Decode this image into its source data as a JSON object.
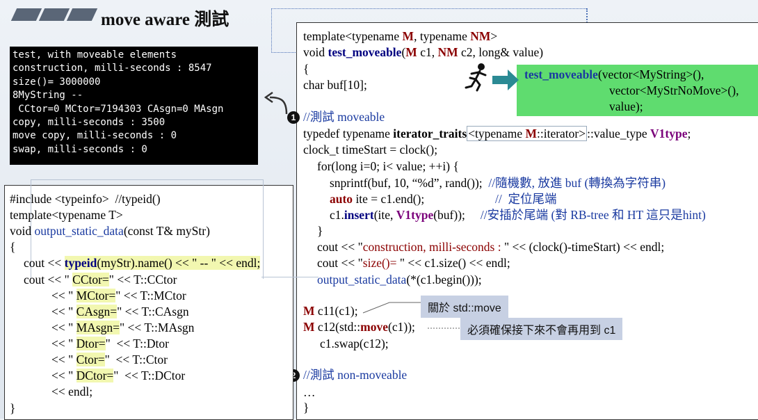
{
  "slide": {
    "title": "move aware 測試"
  },
  "console": {
    "lines": [
      "test, with moveable elements",
      "construction, milli-seconds : 8547",
      "size()= 3000000",
      "8MyString --",
      " CCtor=0 MCtor=7194303 CAsgn=0 MAsgn",
      "copy, milli-seconds : 3500",
      "move copy, milli-seconds : 0",
      "swap, milli-seconds : 0"
    ]
  },
  "right_code": {
    "l1a": "template<typename ",
    "l1b": "M",
    "l1c": ", typename ",
    "l1d": "NM",
    "l1e": ">",
    "l2a": "void ",
    "l2b": "test_moveable",
    "l2c": "(",
    "l2d": "M",
    "l2e": " c1, ",
    "l2f": "NM",
    "l2g": " c2, long& value)",
    "l3": "{",
    "l4": "char buf[10];",
    "c1": "//測試 moveable",
    "l5a": "typedef typename ",
    "l5b": "iterator_traits",
    "l5c": "<typename ",
    "l5d": "M",
    "l5e": "::iterator>",
    "l5f": "::value_type ",
    "l5g": "V1type",
    "l5h": ";",
    "l6": "clock_t timeStart = clock();",
    "l7": "for(long i=0; i< value; ++i) {",
    "l8a": "snprintf(buf, 10, “%d”, rand());  ",
    "l8b": "//隨機數, 放進 buf (轉換為字符串)",
    "l9a": "auto",
    "l9b": " ite = c1.end();",
    "l9c": "//  定位尾端",
    "l10a": "c1.",
    "l10b": "insert",
    "l10c": "(ite, ",
    "l10d": "V1type",
    "l10e": "(buf));",
    "l10f": "//安插於尾端 (對 RB-tree 和 HT 這只是hint)",
    "l11": "}",
    "l12a": "cout << \"",
    "l12b": "construction, milli-seconds : ",
    "l12c": "\" << (clock()-timeStart) << endl;",
    "l13a": "cout << \"",
    "l13b": "size()= ",
    "l13c": "\" << c1.size() << endl;",
    "l14a": "output_static_data",
    "l14b": "(*(c1.begin()));",
    "l15a": "M",
    "l15b": " c11(c1);",
    "l16a": "M",
    "l16b": " c12(std::",
    "l16c": "move",
    "l16d": "(c1));",
    "l17": "c1.swap(c12);",
    "c2": "//測試 non-moveable",
    "l18": "…",
    "l19": "}"
  },
  "call_box": {
    "fn": "test_moveable",
    "a1": "(vector<MyString>(),",
    "a2": "vector<MyStrNoMove>(),",
    "a3": "value);"
  },
  "badges": {
    "one": "1",
    "two": "2"
  },
  "notes": {
    "about_move": "關於 std::move",
    "must_ensure": "必須確保接下來不會再用到 c1"
  },
  "left_code": {
    "l1a": "#include <typeinfo>",
    "l1b": "  //typeid()",
    "l2": "template<typename T>",
    "l3a": "void ",
    "l3b": "output_static_data",
    "l3c": "(const T& myStr)",
    "l4": "{",
    "l5a": "cout << ",
    "l5b": "typeid",
    "l5c": "(myStr).name() << \" -- \" << endl;",
    "l6a": "cout << \" ",
    "l6b": "CCtor=",
    "l6c": "\" << T::CCtor",
    "l7a": "<< \" ",
    "l7b": "MCtor=",
    "l7c": "\" << T::MCtor",
    "l8a": "<< \" ",
    "l8b": "CAsgn=",
    "l8c": "\" << T::CAsgn",
    "l9a": "<< \" ",
    "l9b": "MAsgn=",
    "l9c": "\" << T::MAsgn",
    "l10a": "<< \" ",
    "l10b": "Dtor=",
    "l10c": "\"  << T::Dtor",
    "l11a": "<< \" ",
    "l11b": "Ctor=",
    "l11c": "\"  << T::Ctor",
    "l12a": "<< \" ",
    "l12b": "DCtor=",
    "l12c": "\"  << T::DCtor",
    "l13": "<< endl;",
    "l14": "}"
  },
  "colors": {
    "green_box": "#5fdc6f",
    "note_bg": "#c7d0e3",
    "highlight": "#f2f7b0",
    "console_bg": "#000000"
  }
}
